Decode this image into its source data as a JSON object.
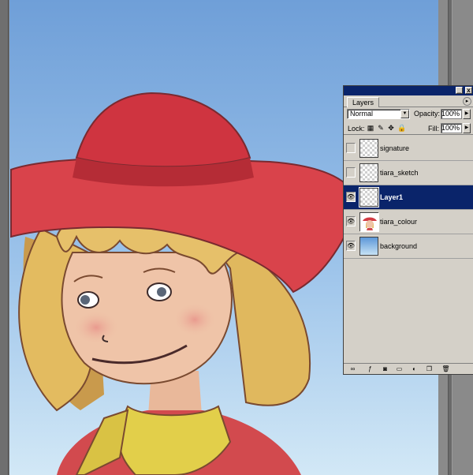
{
  "layers_panel": {
    "tab_label": "Layers",
    "minimize_glyph": "_",
    "close_glyph": "x",
    "menu_glyph": "▸",
    "blend_mode": "Normal",
    "opacity_label": "Opacity:",
    "opacity_value": "100%",
    "lock_label": "Lock:",
    "fill_label": "Fill:",
    "fill_value": "100%",
    "layers": [
      {
        "name": "signature",
        "visible": false,
        "active": false,
        "thumb": "transparent"
      },
      {
        "name": "tiara_sketch",
        "visible": false,
        "active": false,
        "thumb": "transparent"
      },
      {
        "name": "Layer1",
        "visible": true,
        "active": true,
        "thumb": "transparent"
      },
      {
        "name": "tiara_colour",
        "visible": true,
        "active": false,
        "thumb": "character"
      },
      {
        "name": "background",
        "visible": true,
        "active": false,
        "thumb": "gradient"
      }
    ],
    "footer_icons": [
      "link-icon",
      "add-style-icon",
      "add-mask-icon",
      "new-set-icon",
      "adjustment-layer-icon",
      "new-layer-icon",
      "trash-icon"
    ]
  },
  "colors": {
    "canvas_sky_top": "#6f9fd8",
    "canvas_sky_bottom": "#c8e2f3",
    "hat": "#d23c44",
    "hair": "#e6c06a",
    "skin": "#efc4a8",
    "scarf": "#e2cf4a",
    "panel_bg": "#d4d0c8",
    "selection": "#0a246a"
  }
}
